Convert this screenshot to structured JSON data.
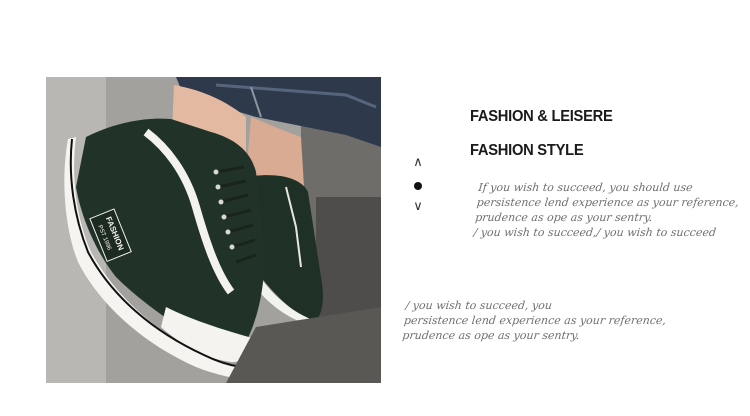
{
  "headings": {
    "line1": "FASHION & LEISERE",
    "line2": "FASHION STYLE"
  },
  "nav": {
    "up": "^",
    "down": "v"
  },
  "shoe_tag": {
    "line1": "FASHION",
    "line2": "PST 1996"
  },
  "text_block_1": {
    "lines": [
      "If you wish to succeed, you should use",
      "persistence  lend experience as your reference,",
      "prudence as ope as your sentry.",
      "/ you wish to succeed,/ you wish to succeed"
    ]
  },
  "text_block_2": {
    "lines": [
      "/ you wish to succeed, you",
      "persistence  lend experience as your reference,",
      "prudence as ope as your sentry."
    ]
  }
}
